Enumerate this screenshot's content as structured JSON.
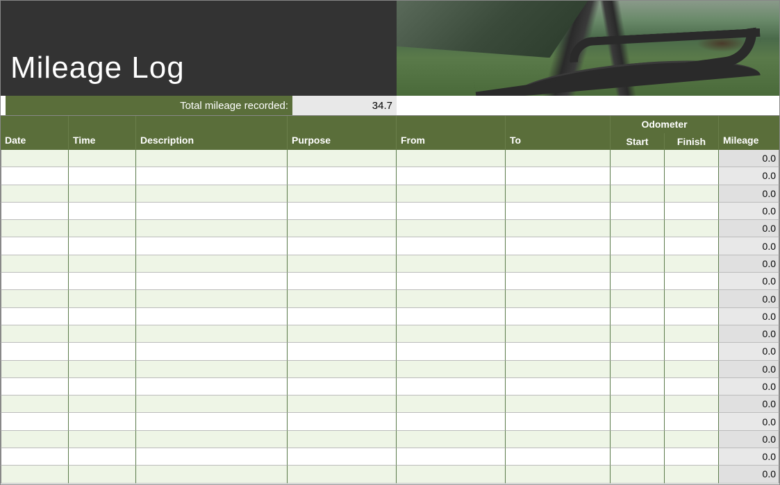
{
  "title": "Mileage Log",
  "total": {
    "label": "Total mileage recorded:",
    "value": "34.7"
  },
  "columns": {
    "date": "Date",
    "time": "Time",
    "description": "Description",
    "purpose": "Purpose",
    "from": "From",
    "to": "To",
    "odometer": "Odometer",
    "start": "Start",
    "finish": "Finish",
    "mileage": "Mileage"
  },
  "rows": [
    {
      "date": "",
      "time": "",
      "description": "",
      "purpose": "",
      "from": "",
      "to": "",
      "start": "",
      "finish": "",
      "mileage": "0.0"
    },
    {
      "date": "",
      "time": "",
      "description": "",
      "purpose": "",
      "from": "",
      "to": "",
      "start": "",
      "finish": "",
      "mileage": "0.0"
    },
    {
      "date": "",
      "time": "",
      "description": "",
      "purpose": "",
      "from": "",
      "to": "",
      "start": "",
      "finish": "",
      "mileage": "0.0"
    },
    {
      "date": "",
      "time": "",
      "description": "",
      "purpose": "",
      "from": "",
      "to": "",
      "start": "",
      "finish": "",
      "mileage": "0.0"
    },
    {
      "date": "",
      "time": "",
      "description": "",
      "purpose": "",
      "from": "",
      "to": "",
      "start": "",
      "finish": "",
      "mileage": "0.0"
    },
    {
      "date": "",
      "time": "",
      "description": "",
      "purpose": "",
      "from": "",
      "to": "",
      "start": "",
      "finish": "",
      "mileage": "0.0"
    },
    {
      "date": "",
      "time": "",
      "description": "",
      "purpose": "",
      "from": "",
      "to": "",
      "start": "",
      "finish": "",
      "mileage": "0.0"
    },
    {
      "date": "",
      "time": "",
      "description": "",
      "purpose": "",
      "from": "",
      "to": "",
      "start": "",
      "finish": "",
      "mileage": "0.0"
    },
    {
      "date": "",
      "time": "",
      "description": "",
      "purpose": "",
      "from": "",
      "to": "",
      "start": "",
      "finish": "",
      "mileage": "0.0"
    },
    {
      "date": "",
      "time": "",
      "description": "",
      "purpose": "",
      "from": "",
      "to": "",
      "start": "",
      "finish": "",
      "mileage": "0.0"
    },
    {
      "date": "",
      "time": "",
      "description": "",
      "purpose": "",
      "from": "",
      "to": "",
      "start": "",
      "finish": "",
      "mileage": "0.0"
    },
    {
      "date": "",
      "time": "",
      "description": "",
      "purpose": "",
      "from": "",
      "to": "",
      "start": "",
      "finish": "",
      "mileage": "0.0"
    },
    {
      "date": "",
      "time": "",
      "description": "",
      "purpose": "",
      "from": "",
      "to": "",
      "start": "",
      "finish": "",
      "mileage": "0.0"
    },
    {
      "date": "",
      "time": "",
      "description": "",
      "purpose": "",
      "from": "",
      "to": "",
      "start": "",
      "finish": "",
      "mileage": "0.0"
    },
    {
      "date": "",
      "time": "",
      "description": "",
      "purpose": "",
      "from": "",
      "to": "",
      "start": "",
      "finish": "",
      "mileage": "0.0"
    },
    {
      "date": "",
      "time": "",
      "description": "",
      "purpose": "",
      "from": "",
      "to": "",
      "start": "",
      "finish": "",
      "mileage": "0.0"
    },
    {
      "date": "",
      "time": "",
      "description": "",
      "purpose": "",
      "from": "",
      "to": "",
      "start": "",
      "finish": "",
      "mileage": "0.0"
    },
    {
      "date": "",
      "time": "",
      "description": "",
      "purpose": "",
      "from": "",
      "to": "",
      "start": "",
      "finish": "",
      "mileage": "0.0"
    },
    {
      "date": "",
      "time": "",
      "description": "",
      "purpose": "",
      "from": "",
      "to": "",
      "start": "",
      "finish": "",
      "mileage": "0.0"
    }
  ]
}
